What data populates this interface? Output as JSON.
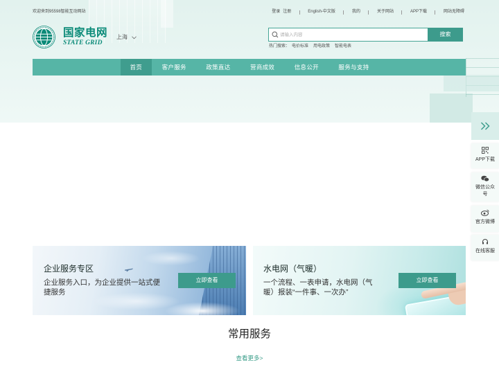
{
  "top_bar": {
    "welcome": "欢迎来到95598智能互动网站",
    "login": "登录",
    "register": "注册",
    "english": "English-中文版",
    "mine": "我的",
    "about": "关于网站",
    "app_download": "APP下载",
    "accessibility": "网站无障碍"
  },
  "logo": {
    "cn": "国家电网",
    "en": "STATE GRID"
  },
  "location": {
    "city": "上海",
    "icon": "chevron-down-icon"
  },
  "search": {
    "placeholder": "请输入内容",
    "button": "搜索",
    "icon": "search-icon",
    "hot_label": "热门搜索：",
    "hot_items": [
      "电价标准",
      "用电政策",
      "智能电表"
    ]
  },
  "nav": {
    "items": [
      {
        "label": "首页",
        "active": true
      },
      {
        "label": "客户服务",
        "active": false
      },
      {
        "label": "政策直达",
        "active": false
      },
      {
        "label": "营商成效",
        "active": false
      },
      {
        "label": "信息公开",
        "active": false
      },
      {
        "label": "服务与支持",
        "active": false
      }
    ]
  },
  "side_toolbar": {
    "toggle_icon": "double-chevron-right-icon",
    "items": [
      {
        "label": "APP下载",
        "icon": "qr-code-icon"
      },
      {
        "label": "微信公众号",
        "icon": "wechat-icon"
      },
      {
        "label": "官方微博",
        "icon": "weibo-icon"
      },
      {
        "label": "在线客服",
        "icon": "headset-icon"
      }
    ]
  },
  "promo_cards": [
    {
      "title": "企业服务专区",
      "description": "企业服务入口，为企业提供一站式便捷服务",
      "button": "立即查看"
    },
    {
      "title": "水电网（气暖）",
      "description": "一个流程、一表申请，水电网（气暖）报装“一件事、一次办”",
      "button": "立即查看"
    }
  ],
  "common_services": {
    "title": "常用服务",
    "more": "查看更多>"
  },
  "colors": {
    "brand": "#0a8a78",
    "nav": "#56b5a6",
    "nav_active": "#3f9d8e",
    "button": "#3d9b8c",
    "link": "#3a9d89",
    "hero_background": "#e2f2ee"
  }
}
